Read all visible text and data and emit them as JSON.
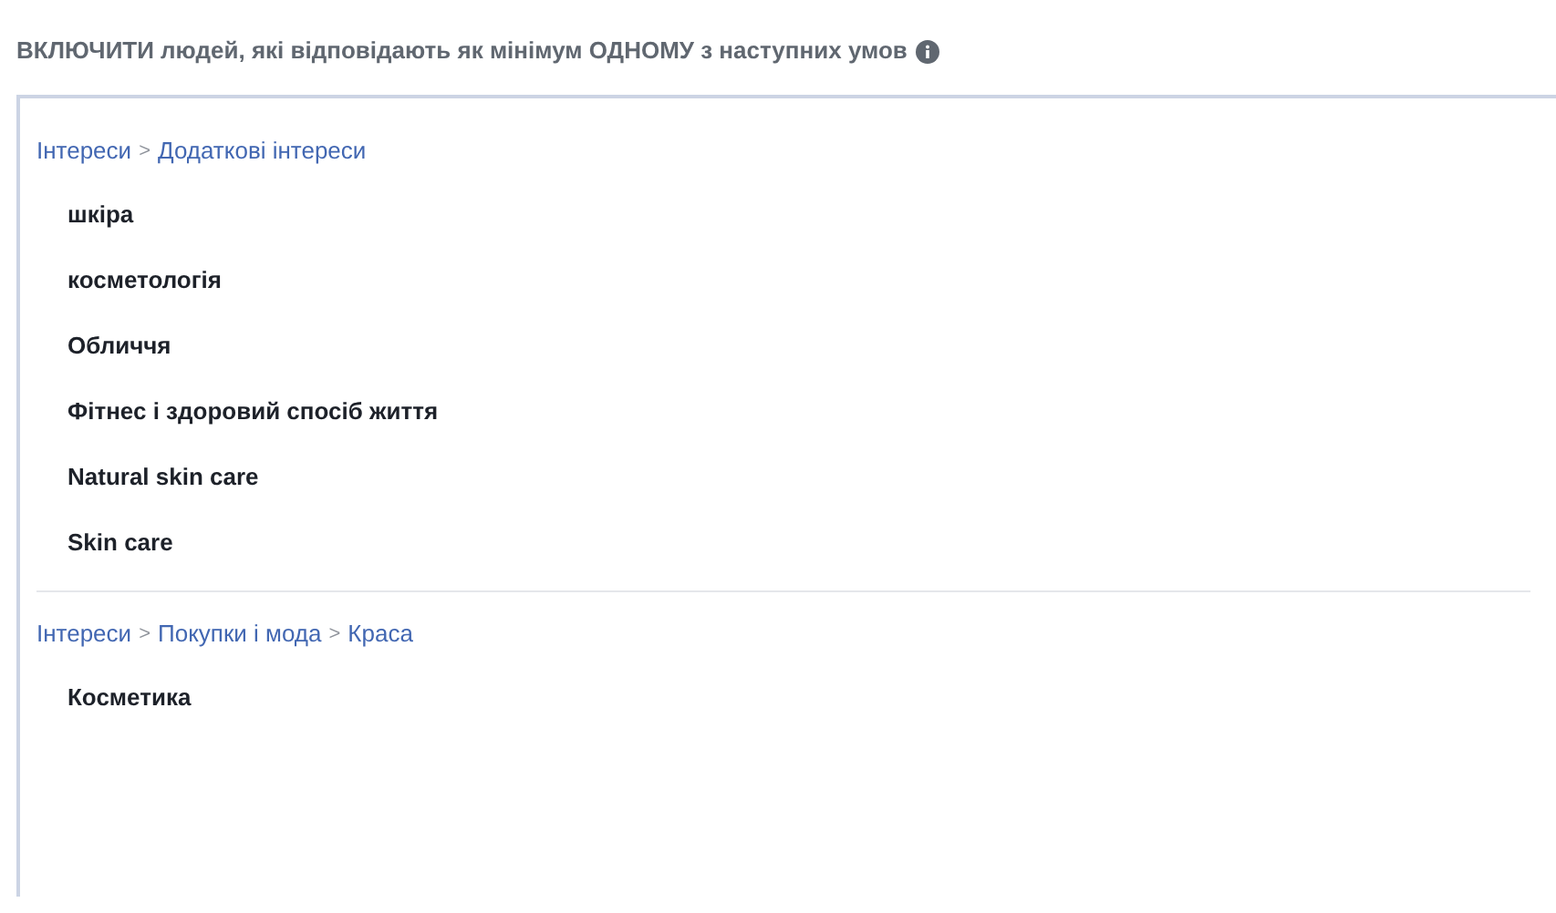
{
  "heading": "ВКЛЮЧИТИ людей, які відповідають як мінімум ОДНОМУ з наступних умов",
  "groups": [
    {
      "path": [
        {
          "kind": "link",
          "text": "Інтереси"
        },
        {
          "kind": "separator",
          "text": ">"
        },
        {
          "kind": "link",
          "text": "Додаткові інтереси"
        }
      ],
      "items": [
        "шкіра",
        "косметологія",
        "Обличчя",
        "Фітнес і здоровий спосіб життя",
        "Natural skin care",
        "Skin care"
      ]
    },
    {
      "path": [
        {
          "kind": "link",
          "text": "Інтереси"
        },
        {
          "kind": "separator",
          "text": ">"
        },
        {
          "kind": "link",
          "text": "Покупки і мода"
        },
        {
          "kind": "separator",
          "text": ">"
        },
        {
          "kind": "link",
          "text": "Краса"
        }
      ],
      "items": [
        "Косметика"
      ]
    }
  ]
}
